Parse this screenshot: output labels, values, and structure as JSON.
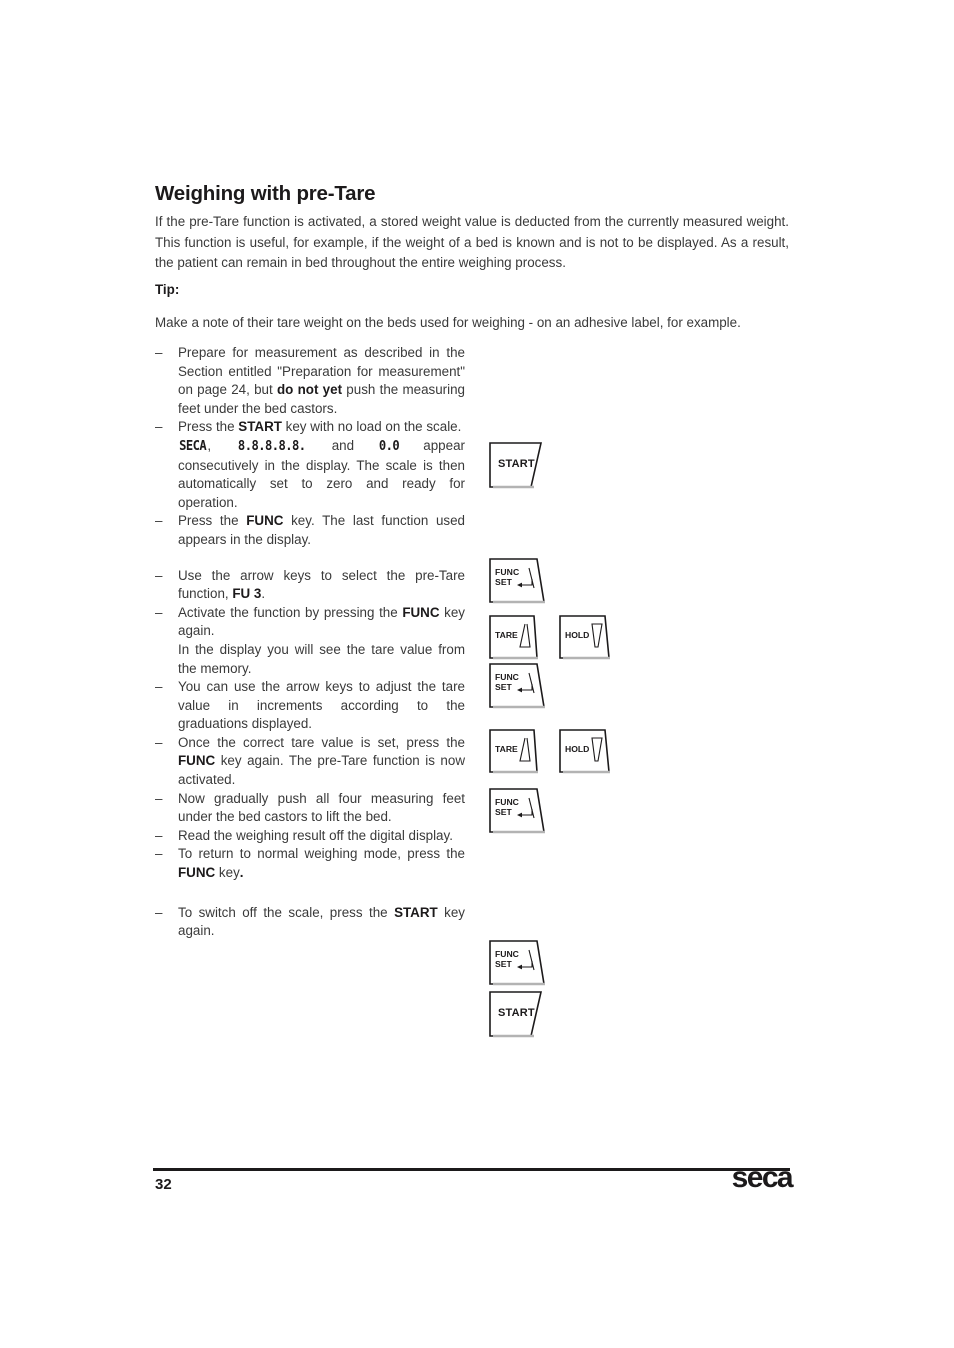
{
  "document": {
    "heading": "Weighing with pre-Tare",
    "intro": "If the pre-Tare function is activated, a stored weight value is deducted from the currently measured weight. This function is useful, for example, if the weight of a bed is known and is not to be displayed. As a result, the patient can remain in bed throughout the entire weighing process.",
    "tip_label": "Tip:",
    "tip_body": "Make a note of their tare weight on the beds used for weighing - on an adhesive label, for example."
  },
  "steps": {
    "dash": "–",
    "s1": {
      "a": "Prepare for measurement as described in the Section entitled \"Preparation for measurement\" on page 24, but ",
      "b": "do not yet",
      "c": " push the measuring feet under the bed castors."
    },
    "s2": {
      "a": "Press the ",
      "b": "START",
      "c": " key with no load on the scale.",
      "display1": "SECA",
      "sep1": ", ",
      "display2": "8.8.8.8.8.",
      "mid": " and ",
      "display3": "0.0",
      "tail": " appear consecutively in the display. The scale is then automatically set to zero and ready for operation."
    },
    "s3": {
      "a": "Press the ",
      "b": "FUNC",
      "c": " key. The last function used appears in the display."
    },
    "s4": {
      "a": "Use the arrow keys to select the pre-Tare function, ",
      "b": "FU 3",
      "c": "."
    },
    "s5": {
      "a": "Activate the function by pressing the ",
      "b": "FUNC",
      "c": " key again.",
      "sub": "In the display you will see the tare value from the memory."
    },
    "s6": {
      "a": "You can use the arrow keys to adjust the tare value in increments according to the graduations displayed."
    },
    "s7": {
      "a": "Once the correct tare value is set, press the ",
      "b": "FUNC",
      "c": " key again. The pre-Tare function is now activated."
    },
    "s8": {
      "a": "Now gradually push all four measuring feet under the bed castors to lift the bed."
    },
    "s9": {
      "a": "Read the weighing result off the digital display."
    },
    "s10": {
      "a": "To return to normal weighing mode, press the ",
      "b": "FUNC",
      "c": " key",
      "d": "."
    },
    "s11": {
      "a": "To switch off the scale, press the ",
      "b": "START",
      "c": " key again."
    }
  },
  "keys": {
    "start": "START",
    "func": "FUNC",
    "set": "SET",
    "tare": "TARE",
    "hold": "HOLD"
  },
  "footer": {
    "page_number": "32",
    "logo": "seca"
  },
  "colors": {
    "text": "#3a3a3a",
    "heading": "#1c1a1b",
    "rule": "#1c1a1b",
    "key_outline": "#1c1a1b",
    "key_shadow": "#b3b3b3",
    "background": "#ffffff"
  }
}
